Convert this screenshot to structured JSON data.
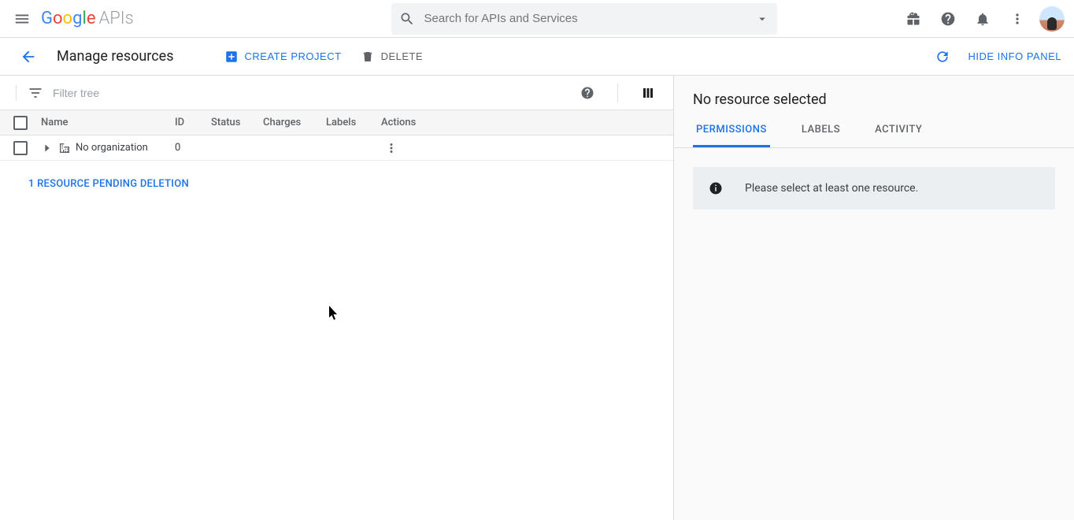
{
  "brand": {
    "google": "Google",
    "product": "APIs"
  },
  "search": {
    "placeholder": "Search for APIs and Services"
  },
  "page": {
    "title": "Manage resources",
    "create_label": "CREATE PROJECT",
    "delete_label": "DELETE",
    "refresh_aria": "Refresh",
    "hide_panel_label": "HIDE INFO PANEL"
  },
  "filter": {
    "placeholder": "Filter tree"
  },
  "table": {
    "columns": {
      "name": "Name",
      "id": "ID",
      "status": "Status",
      "charges": "Charges",
      "labels": "Labels",
      "actions": "Actions"
    },
    "rows": [
      {
        "name": "No organization",
        "id": "0",
        "status": "",
        "charges": "",
        "labels": ""
      }
    ],
    "pending_link": "1 RESOURCE PENDING DELETION"
  },
  "side": {
    "title": "No resource selected",
    "tabs": {
      "permissions": "PERMISSIONS",
      "labels": "LABELS",
      "activity": "ACTIVITY"
    },
    "notice": "Please select at least one resource."
  }
}
